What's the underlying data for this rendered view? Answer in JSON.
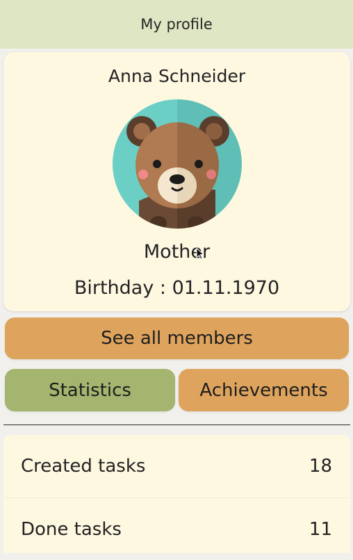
{
  "app_bar": {
    "title": "My profile"
  },
  "profile": {
    "name": "Anna Schneider",
    "avatar_icon": "bear-avatar-icon",
    "role": "Mother",
    "birthday": "Birthday : 01.11.1970"
  },
  "actions": {
    "see_all_members": "See all members"
  },
  "tabs": [
    {
      "label": "Statistics",
      "selected": true
    },
    {
      "label": "Achievements",
      "selected": false
    }
  ],
  "statistics": [
    {
      "label": "Created tasks",
      "value": "18"
    },
    {
      "label": "Done tasks",
      "value": "11"
    }
  ],
  "colors": {
    "app_bar": "#dfe6c3",
    "card": "#fef8e1",
    "accent_orange": "#dea45d",
    "accent_green": "#a3b56f",
    "background": "#f1f0ec"
  }
}
